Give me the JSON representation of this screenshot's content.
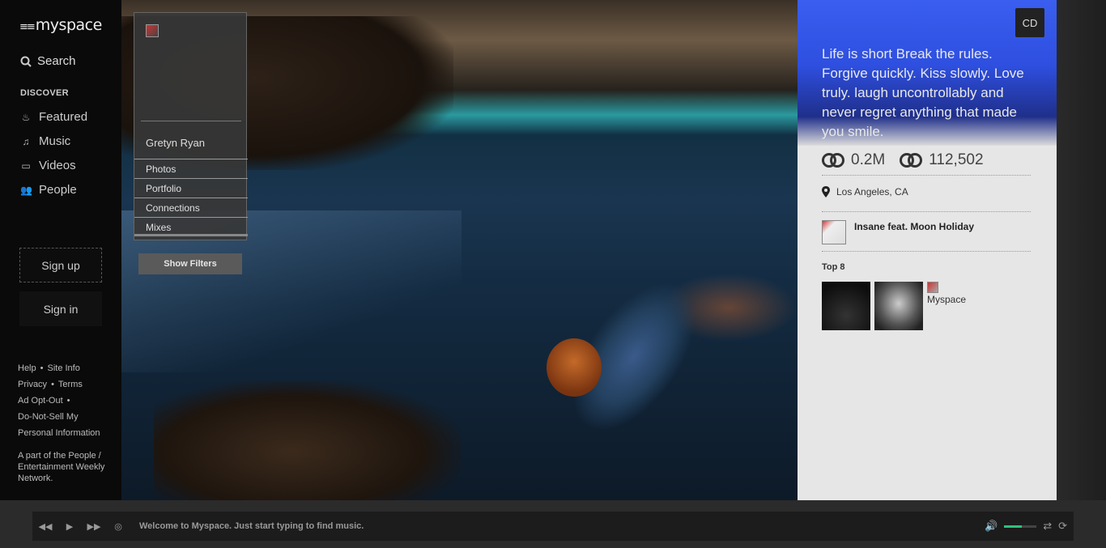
{
  "sidebar": {
    "logo": "myspace",
    "search_label": "Search",
    "discover_label": "DISCOVER",
    "nav": [
      {
        "label": "Featured",
        "icon": "flame-icon"
      },
      {
        "label": "Music",
        "icon": "music-note-icon"
      },
      {
        "label": "Videos",
        "icon": "video-icon"
      },
      {
        "label": "People",
        "icon": "people-icon"
      }
    ],
    "signup_label": "Sign up",
    "signin_label": "Sign in",
    "footer": {
      "help": "Help",
      "site_info": "Site Info",
      "privacy": "Privacy",
      "terms": "Terms",
      "ad_opt_out": "Ad Opt-Out",
      "do_not_sell": "Do-Not-Sell My Personal Information",
      "network": "A part of the People / Entertainment Weekly Network."
    }
  },
  "card": {
    "name": "Gretyn Ryan",
    "links": [
      "Photos",
      "Portfolio",
      "Connections",
      "Mixes"
    ],
    "show_filters": "Show Filters"
  },
  "panel": {
    "connect_button": "CD",
    "quote": "Life is short Break the rules. Forgive quickly. Kiss slowly. Love truly. laugh uncontrollably and never regret anything that made you smile.",
    "followers": "0.2M",
    "following": "112,502",
    "location": "Los Angeles, CA",
    "song": "Insane feat. Moon Holiday",
    "top8_label": "Top 8",
    "top8_name": "Myspace"
  },
  "player": {
    "ticker": "Welcome to Myspace. Just start typing to find music.",
    "volume": 0.55
  }
}
